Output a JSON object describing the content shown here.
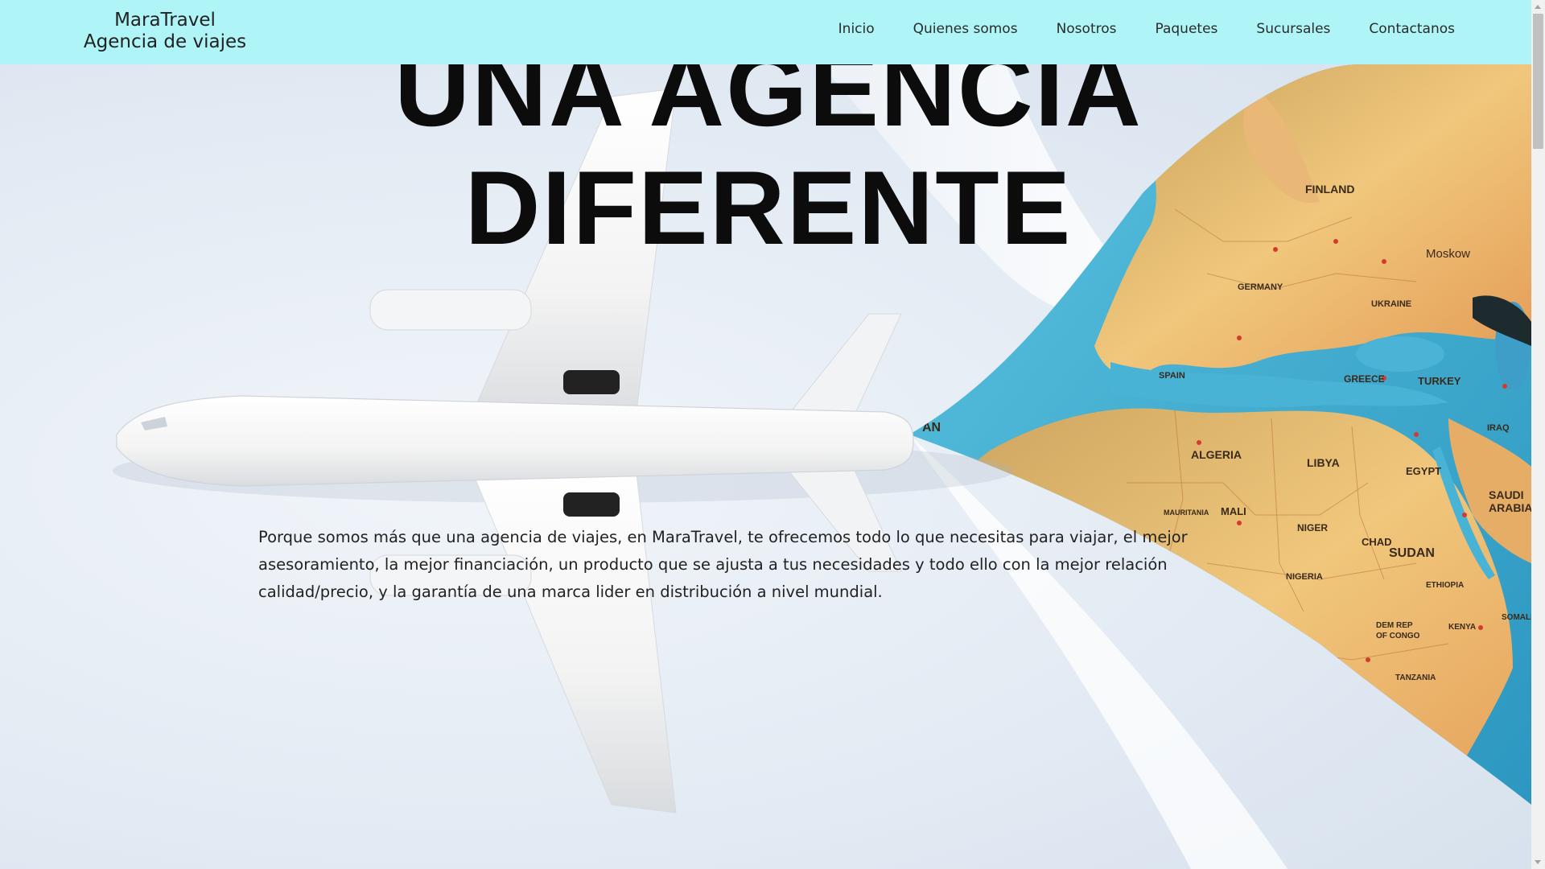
{
  "brand": {
    "line1": "MaraTravel",
    "line2": "Agencia de viajes"
  },
  "nav": {
    "items": [
      {
        "label": "Inicio"
      },
      {
        "label": "Quienes somos"
      },
      {
        "label": "Nosotros"
      },
      {
        "label": "Paquetes"
      },
      {
        "label": "Sucursales"
      },
      {
        "label": "Contactanos"
      }
    ]
  },
  "hero": {
    "headline_line1": "UNA AGENCIA",
    "headline_line2": "DIFERENTE",
    "paragraph": "Porque somos más que una agencia de viajes, en MaraTravel, te ofrecemos todo lo que necesitas para viajar, el mejor asesoramiento, la mejor financiación, un producto que se ajusta a tus necesidades y todo ello con la mejor relación calidad/precio, y la garantía de una marca lider en distribución a nivel mundial."
  },
  "map_labels": {
    "finland": "FINLAND",
    "moskow": "Moskow",
    "germany": "GERMANY",
    "ukraine": "UKRAINE",
    "spain": "SPAIN",
    "greece": "GREECE",
    "turkey": "TURKEY",
    "algeria": "ALGERIA",
    "libya": "LIBYA",
    "egypt": "EGYPT",
    "saudi": "SAUDI",
    "arabia": "ARABIA",
    "mali": "MALI",
    "niger": "NIGER",
    "chad": "CHAD",
    "sudan": "SUDAN",
    "nigeria": "NIGERIA",
    "ethiopia": "ETHIOPIA",
    "kenya": "KENYA",
    "tanzania": "TANZANIA",
    "iraq": "IRAQ",
    "an": "AN",
    "dem_rep": "DEM REP",
    "of_congo": "OF CONGO",
    "somalia": "SOMALIA",
    "mauritania": "MAURITANIA"
  },
  "colors": {
    "navbar_bg": "#aff5f7",
    "headline": "#0c0c0c",
    "ocean": "#3aa7c9",
    "land": "#efc276"
  }
}
